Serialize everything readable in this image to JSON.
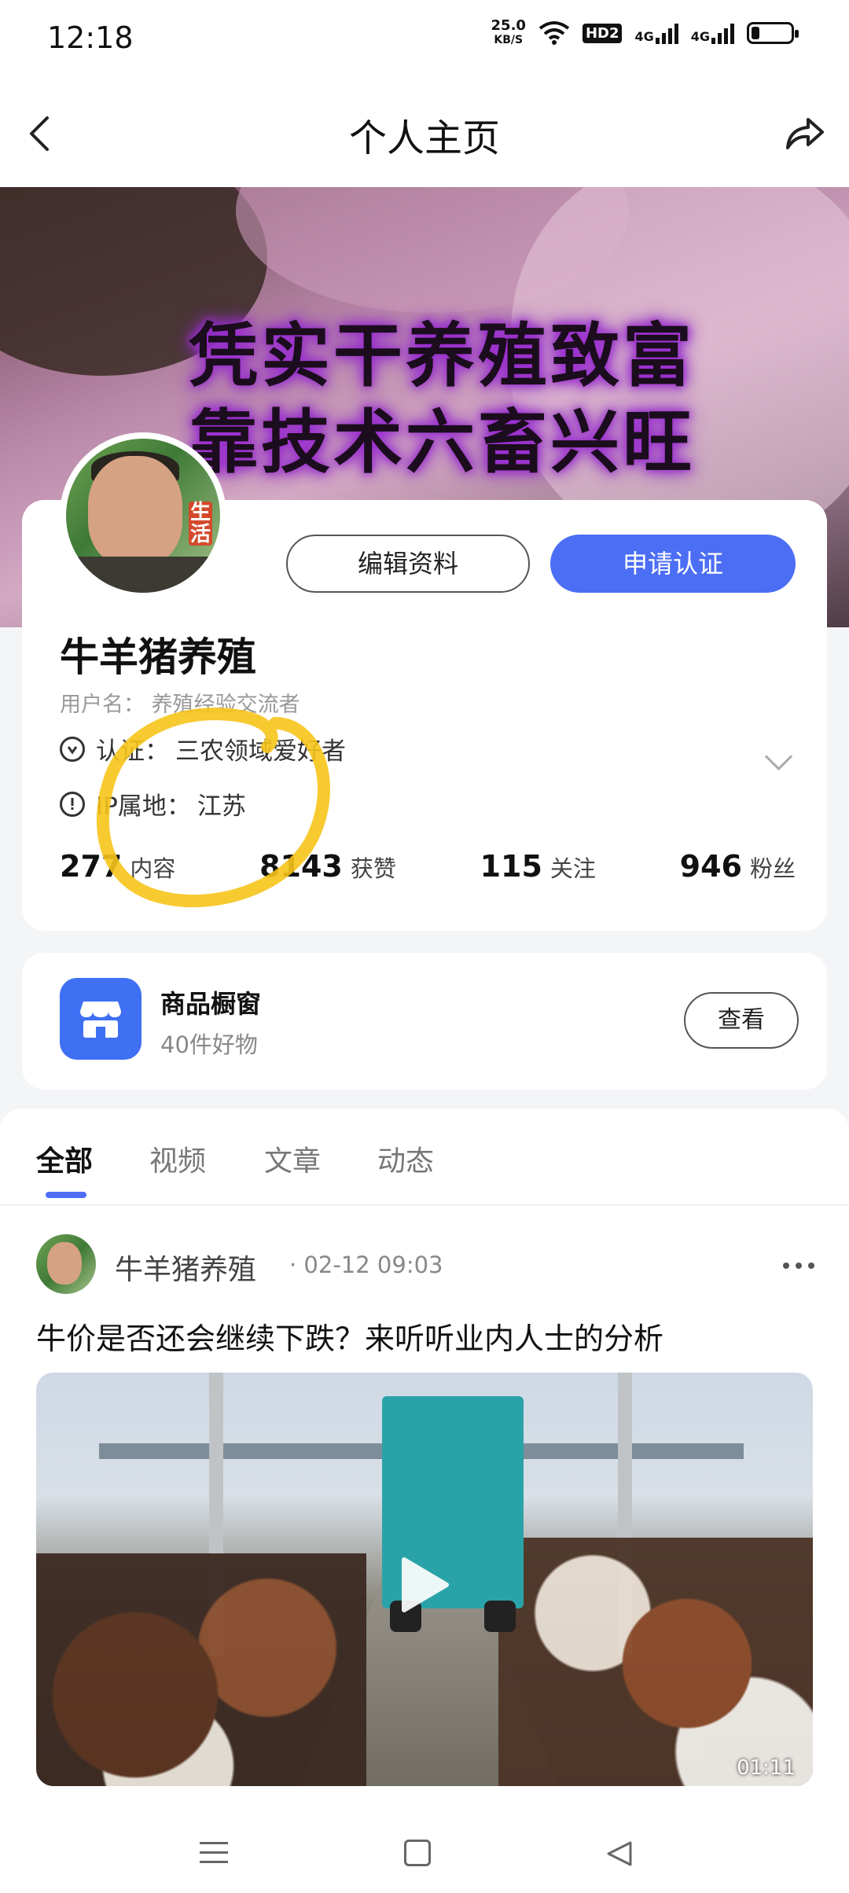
{
  "status_bar": {
    "time": "12:18",
    "speed_value": "25.0",
    "speed_unit": "KB/S",
    "hd": "HD2",
    "net1": "4G",
    "net2": "4G",
    "battery_level": 0.2
  },
  "nav": {
    "title": "个人主页"
  },
  "banner": {
    "line1": "凭实干养殖致富",
    "line2": "靠技术六畜兴旺"
  },
  "profile": {
    "edit_label": "编辑资料",
    "apply_label": "申请认证",
    "name": "牛羊猪养殖",
    "username_label": "用户名：",
    "username": "养殖经验交流者",
    "cert_label": "认证：",
    "cert_value": "三农领域爱好者",
    "ip_label": "IP属地：",
    "ip_value": "江苏",
    "avatar_tag": "生活",
    "stats": [
      {
        "num": "277",
        "label": "内容"
      },
      {
        "num": "8143",
        "label": "获赞"
      },
      {
        "num": "115",
        "label": "关注"
      },
      {
        "num": "946",
        "label": "粉丝"
      }
    ]
  },
  "shop": {
    "title": "商品橱窗",
    "subtitle": "40件好物",
    "button": "查看"
  },
  "tabs": [
    {
      "label": "全部",
      "active": true
    },
    {
      "label": "视频",
      "active": false
    },
    {
      "label": "文章",
      "active": false
    },
    {
      "label": "动态",
      "active": false
    }
  ],
  "post": {
    "author": "牛羊猪养殖",
    "time": "· 02-12 09:03",
    "title": "牛价是否还会继续下跌？来听听业内人士的分析",
    "duration": "01:11"
  },
  "colors": {
    "accent": "#4c6ef5",
    "shop_icon": "#3f6ff3",
    "annotation": "#f6c41a"
  }
}
